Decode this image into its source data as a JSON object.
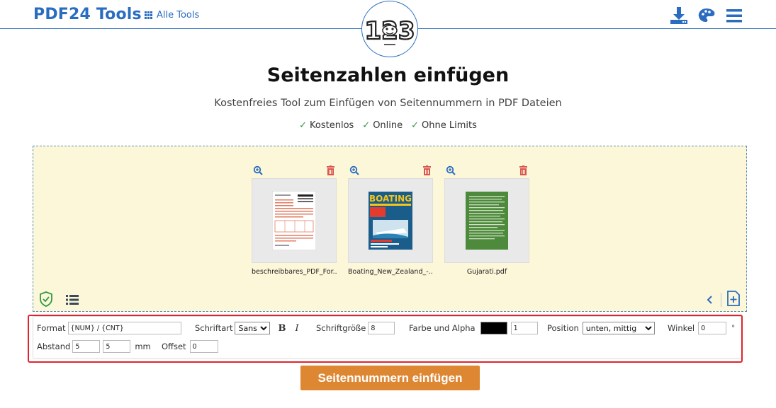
{
  "header": {
    "brand": "PDF24 Tools",
    "all_tools_label": "Alle Tools"
  },
  "logo_text": "123",
  "page": {
    "title": "Seitenzahlen einfügen",
    "subtitle": "Kostenfreies Tool zum Einfügen von Seitennummern in PDF Dateien",
    "features": [
      "Kostenlos",
      "Online",
      "Ohne Limits"
    ]
  },
  "files": [
    {
      "name": "beschreibbares_PDF_For...",
      "thumb_color": "#ffffff"
    },
    {
      "name": "Boating_New_Zealand_-...",
      "thumb_color": "#1b5d8a"
    },
    {
      "name": "Gujarati.pdf",
      "thumb_color": "#4d8a3b"
    }
  ],
  "options": {
    "format_label": "Format",
    "format_value": "{NUM} / {CNT}",
    "font_label": "Schriftart",
    "font_value": "Sans",
    "bold_label": "B",
    "italic_label": "I",
    "size_label": "Schriftgröße",
    "size_value": "8",
    "color_label": "Farbe und Alpha",
    "color_value": "#000000",
    "alpha_value": "1",
    "position_label": "Position",
    "position_value": "unten, mittig",
    "angle_label": "Winkel",
    "angle_value": "0",
    "angle_unit": "°",
    "margin_label": "Abstand",
    "margin_x": "5",
    "margin_y": "5",
    "margin_unit": "mm",
    "offset_label": "Offset",
    "offset_value": "0"
  },
  "submit_label": "Seitennummern einfügen",
  "colors": {
    "brand_blue": "#2a6cc0",
    "dropzone_bg": "#fdf7d9",
    "submit_orange": "#de8733",
    "delete_red": "#d9534f",
    "highlight_red": "#e0232b"
  }
}
